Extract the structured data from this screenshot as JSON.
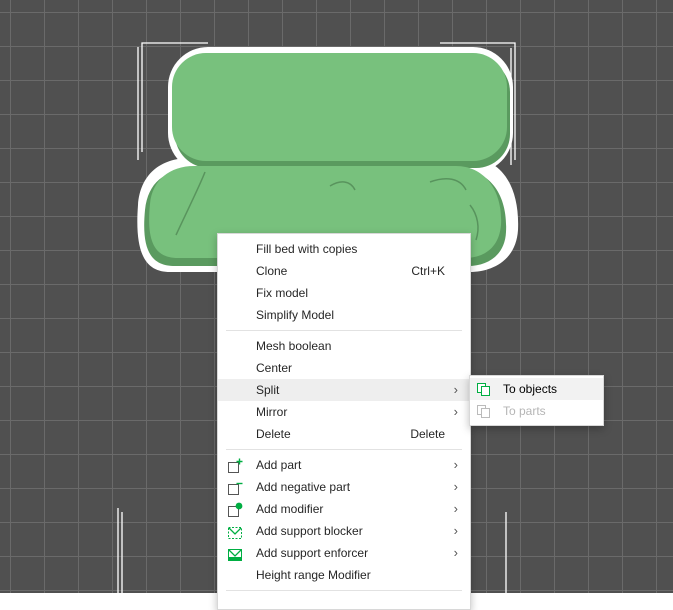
{
  "colors": {
    "accent": "#00ae42",
    "model": "#78c17d",
    "model_dark": "#5a9a5f",
    "background": "#505050"
  },
  "context_menu": {
    "items": [
      {
        "label": "Fill bed with copies"
      },
      {
        "label": "Clone",
        "shortcut": "Ctrl+K"
      },
      {
        "label": "Fix model"
      },
      {
        "label": "Simplify Model"
      },
      {
        "label": "Mesh boolean"
      },
      {
        "label": "Center"
      },
      {
        "label": "Split",
        "submenu_arrow": "›",
        "highlighted": true
      },
      {
        "label": "Mirror",
        "submenu_arrow": "›"
      },
      {
        "label": "Delete",
        "shortcut": "Delete"
      },
      {
        "label": "Add part",
        "submenu_arrow": "›",
        "icon": "add-part-icon"
      },
      {
        "label": "Add negative part",
        "submenu_arrow": "›",
        "icon": "add-negative-part-icon"
      },
      {
        "label": "Add modifier",
        "submenu_arrow": "›",
        "icon": "add-modifier-icon"
      },
      {
        "label": "Add support blocker",
        "submenu_arrow": "›",
        "icon": "support-blocker-icon"
      },
      {
        "label": "Add support enforcer",
        "submenu_arrow": "›",
        "icon": "support-enforcer-icon"
      },
      {
        "label": "Height range Modifier"
      }
    ]
  },
  "split_submenu": {
    "items": [
      {
        "label": "To objects",
        "icon": "split-to-objects-icon",
        "enabled": true
      },
      {
        "label": "To parts",
        "icon": "split-to-parts-icon",
        "enabled": false
      }
    ]
  }
}
